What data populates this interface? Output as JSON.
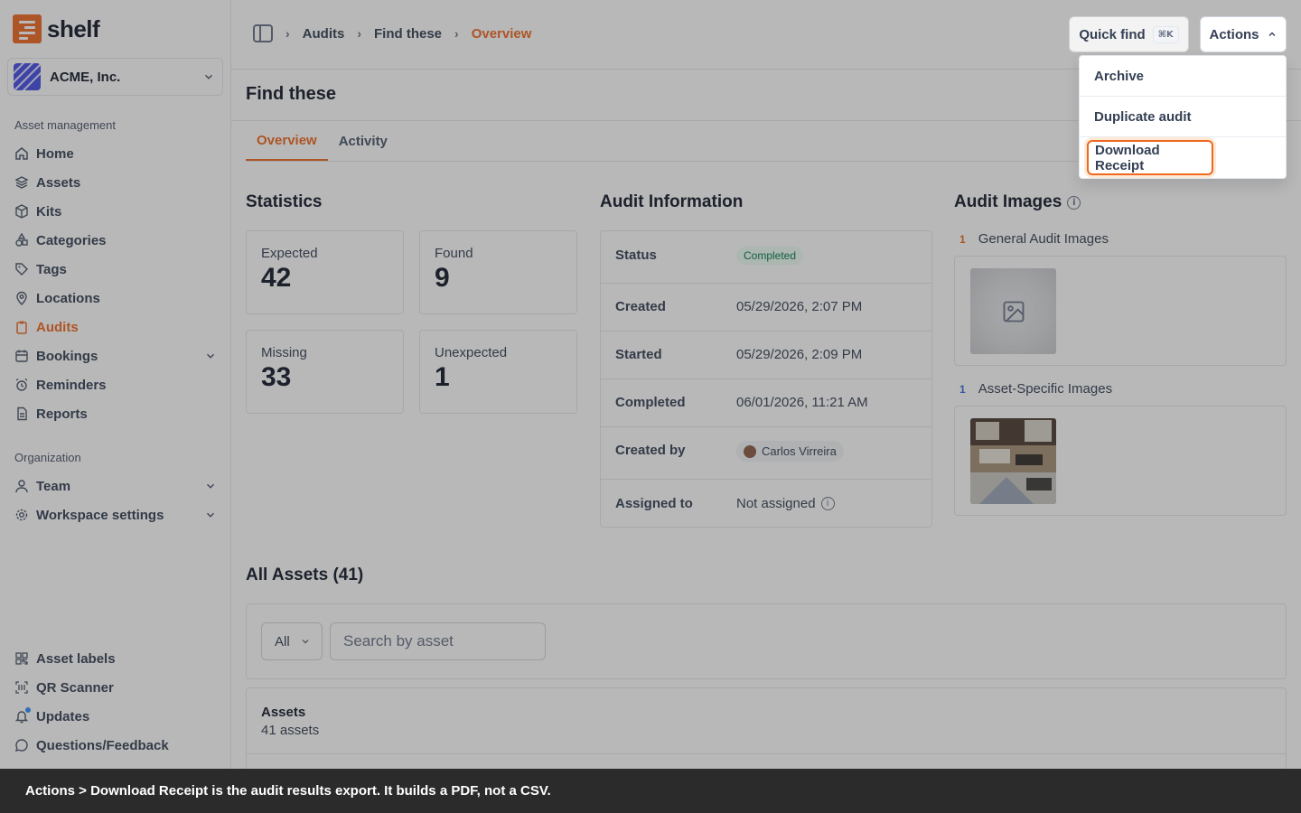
{
  "brand": {
    "name": "shelf"
  },
  "org": {
    "name": "ACME, Inc."
  },
  "sidebar": {
    "section_asset": "Asset management",
    "section_org": "Organization",
    "items": [
      {
        "label": "Home",
        "icon": "home-icon"
      },
      {
        "label": "Assets",
        "icon": "layers-icon"
      },
      {
        "label": "Kits",
        "icon": "box-icon"
      },
      {
        "label": "Categories",
        "icon": "shapes-icon"
      },
      {
        "label": "Tags",
        "icon": "tag-icon"
      },
      {
        "label": "Locations",
        "icon": "pin-icon"
      },
      {
        "label": "Audits",
        "icon": "clipboard-icon",
        "active": true
      },
      {
        "label": "Bookings",
        "icon": "calendar-icon",
        "expandable": true
      },
      {
        "label": "Reminders",
        "icon": "alarm-icon"
      },
      {
        "label": "Reports",
        "icon": "report-icon"
      }
    ],
    "org_items": [
      {
        "label": "Team",
        "icon": "user-icon",
        "expandable": true
      },
      {
        "label": "Workspace settings",
        "icon": "gear-icon",
        "expandable": true
      }
    ],
    "bottom_items": [
      {
        "label": "Asset labels",
        "icon": "qr-icon"
      },
      {
        "label": "QR Scanner",
        "icon": "scan-icon"
      },
      {
        "label": "Updates",
        "icon": "bell-icon",
        "has_dot": true
      },
      {
        "label": "Questions/Feedback",
        "icon": "chat-icon"
      }
    ]
  },
  "breadcrumb": [
    "Audits",
    "Find these",
    "Overview"
  ],
  "header": {
    "quick_find": "Quick find",
    "quick_find_shortcut": "⌘K",
    "actions": "Actions"
  },
  "actions_menu": [
    "Archive",
    "Duplicate audit",
    "Download Receipt"
  ],
  "page": {
    "title": "Find these",
    "tabs": [
      "Overview",
      "Activity"
    ],
    "active_tab": "Overview"
  },
  "statistics": {
    "title": "Statistics",
    "items": [
      {
        "label": "Expected",
        "value": "42"
      },
      {
        "label": "Found",
        "value": "9"
      },
      {
        "label": "Missing",
        "value": "33"
      },
      {
        "label": "Unexpected",
        "value": "1"
      }
    ]
  },
  "audit_info": {
    "title": "Audit Information",
    "rows": [
      {
        "label": "Status",
        "value": "Completed"
      },
      {
        "label": "Created",
        "value": "05/29/2026, 2:07 PM"
      },
      {
        "label": "Started",
        "value": "05/29/2026, 2:09 PM"
      },
      {
        "label": "Completed",
        "value": "06/01/2026, 11:21 AM"
      },
      {
        "label": "Created by",
        "value": "Carlos Virreira"
      },
      {
        "label": "Assigned to",
        "value": "Not assigned"
      }
    ]
  },
  "audit_images": {
    "title": "Audit Images",
    "groups": [
      {
        "count": "1",
        "label": "General Audit Images",
        "count_color": "#ef6820"
      },
      {
        "count": "1",
        "label": "Asset-Specific Images",
        "count_color": "#2e6fd8"
      }
    ]
  },
  "all_assets": {
    "title": "All Assets (41)",
    "filter_value": "All",
    "search_placeholder": "Search by asset",
    "table_title": "Assets",
    "table_count": "41 assets"
  },
  "caption": "Actions > Download Receipt is the audit results export. It builds a PDF, not a CSV.",
  "colors": {
    "accent": "#ef6820",
    "status_green": "#067647",
    "overlay": "#343434"
  }
}
